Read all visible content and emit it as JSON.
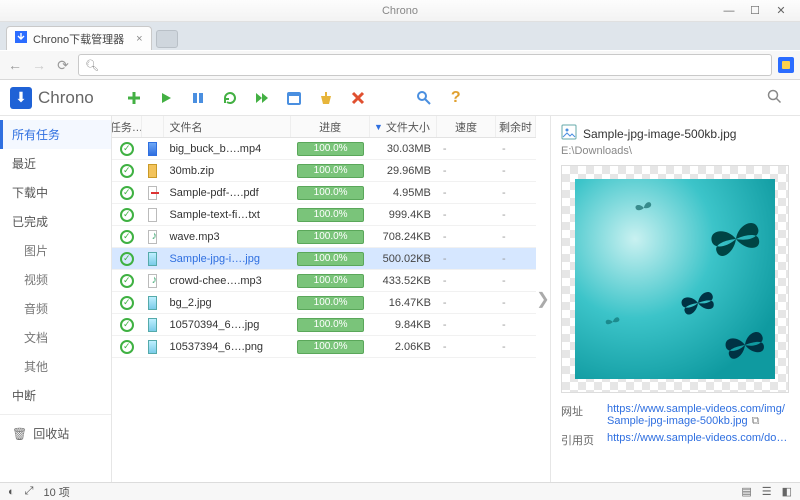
{
  "window": {
    "app_name": "Chrono",
    "min": "—",
    "max": "☐",
    "close": "✕"
  },
  "browser": {
    "tab_title": "Chrono下载管理器",
    "url_placeholder": ""
  },
  "app": {
    "name": "Chrono",
    "toolbar": {
      "add": "add",
      "start": "start",
      "pause": "pause",
      "refresh": "refresh",
      "resume_all": "resume-all",
      "schedule": "schedule",
      "clean": "clean",
      "delete": "delete",
      "find": "find",
      "help": "help"
    }
  },
  "sidebar": {
    "all": "所有任务",
    "recent": "最近",
    "downloading": "下载中",
    "completed": "已完成",
    "image": "图片",
    "video": "视频",
    "audio": "音频",
    "document": "文档",
    "other": "其他",
    "interrupted": "中断",
    "trash": "回收站"
  },
  "columns": {
    "task": "任务…",
    "name": "文件名",
    "progress": "进度",
    "size": "文件大小",
    "speed": "速度",
    "eta": "剩余时"
  },
  "rows": [
    {
      "icon": "video",
      "name": "big_buck_b….mp4",
      "progress": "100.0%",
      "size": "30.03MB",
      "speed": "-",
      "eta": "-",
      "sel": false,
      "link": false
    },
    {
      "icon": "archive",
      "name": "30mb.zip",
      "progress": "100.0%",
      "size": "29.96MB",
      "speed": "-",
      "eta": "-",
      "sel": false,
      "link": false
    },
    {
      "icon": "pdf",
      "name": "Sample-pdf-….pdf",
      "progress": "100.0%",
      "size": "4.95MB",
      "speed": "-",
      "eta": "-",
      "sel": false,
      "link": false
    },
    {
      "icon": "text",
      "name": "Sample-text-fi…txt",
      "progress": "100.0%",
      "size": "999.4KB",
      "speed": "-",
      "eta": "-",
      "sel": false,
      "link": false
    },
    {
      "icon": "audio",
      "name": "wave.mp3",
      "progress": "100.0%",
      "size": "708.24KB",
      "speed": "-",
      "eta": "-",
      "sel": false,
      "link": false
    },
    {
      "icon": "image",
      "name": "Sample-jpg-i….jpg",
      "progress": "100.0%",
      "size": "500.02KB",
      "speed": "-",
      "eta": "-",
      "sel": true,
      "link": true
    },
    {
      "icon": "audio",
      "name": "crowd-chee….mp3",
      "progress": "100.0%",
      "size": "433.52KB",
      "speed": "-",
      "eta": "-",
      "sel": false,
      "link": false
    },
    {
      "icon": "image",
      "name": "bg_2.jpg",
      "progress": "100.0%",
      "size": "16.47KB",
      "speed": "-",
      "eta": "-",
      "sel": false,
      "link": false
    },
    {
      "icon": "image",
      "name": "10570394_6….jpg",
      "progress": "100.0%",
      "size": "9.84KB",
      "speed": "-",
      "eta": "-",
      "sel": false,
      "link": false
    },
    {
      "icon": "image",
      "name": "10537394_6….png",
      "progress": "100.0%",
      "size": "2.06KB",
      "speed": "-",
      "eta": "-",
      "sel": false,
      "link": false
    }
  ],
  "detail": {
    "filename": "Sample-jpg-image-500kb.jpg",
    "path": "E:\\Downloads\\",
    "url_label": "网址",
    "url_value": "https://www.sample-videos.com/img/Sample-jpg-image-500kb.jpg",
    "referrer_label": "引用页",
    "referrer_value": "https://www.sample-videos.com/downlo"
  },
  "status": {
    "count": "10 项"
  }
}
